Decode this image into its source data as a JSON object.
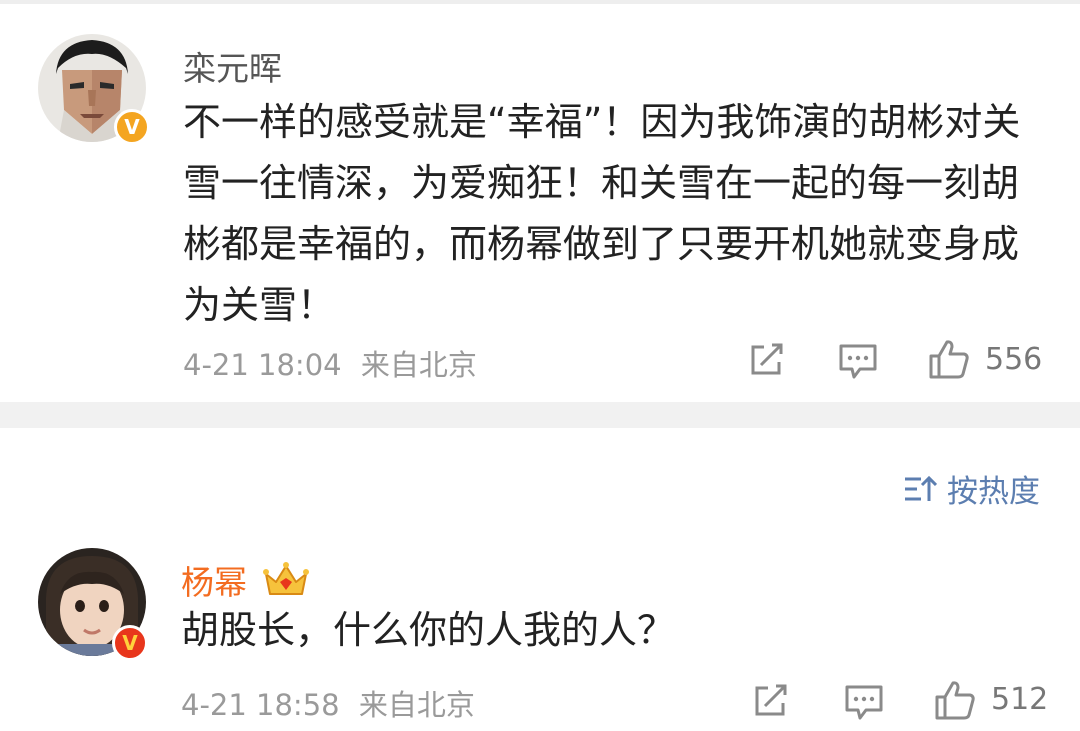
{
  "comments": [
    {
      "username": "栾元晖",
      "badge": "V",
      "text": "不一样的感受就是“幸福”！因为我饰演的胡彬对关雪一往情深，为爱痴狂！和关雪在一起的每一刻胡彬都是幸福的，而杨幂做到了只要开机她就变身成为关雪！",
      "time": "4-21 18:04",
      "source": "来自北京",
      "likes": "556"
    },
    {
      "username": "杨幂",
      "badge": "V",
      "text": "胡股长，什么你的人我的人？",
      "time": "4-21 18:58",
      "source": "来自北京",
      "likes": "512"
    }
  ],
  "sort": {
    "label": "按热度"
  },
  "colors": {
    "accent_blue": "#5c7eb0",
    "vip_orange": "#f36c20",
    "badge_gold": "#f4a521",
    "badge_red": "#e8361c"
  },
  "icons": [
    "share-icon",
    "comment-icon",
    "like-icon",
    "sort-icon",
    "crown-icon",
    "verified-icon"
  ]
}
